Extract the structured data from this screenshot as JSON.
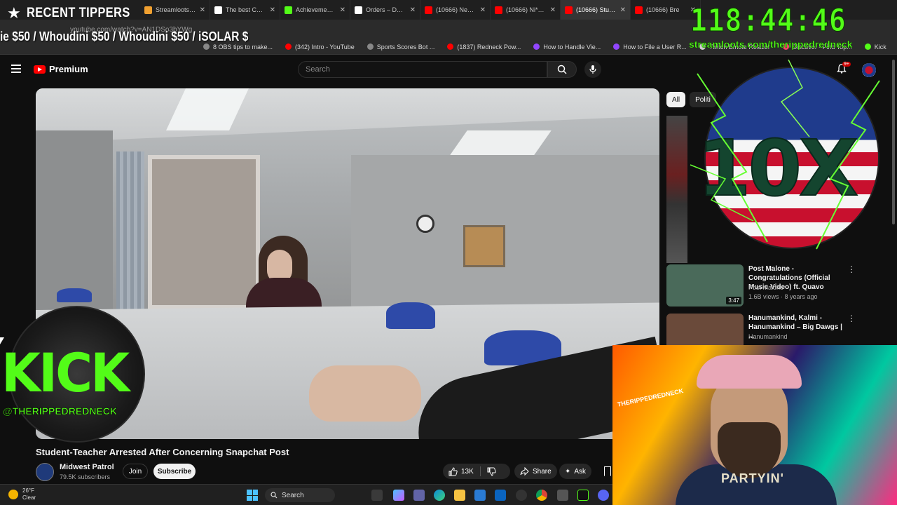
{
  "browser": {
    "tabs": [
      {
        "label": "Streamloots | Th",
        "color": "#f0a030",
        "active": false
      },
      {
        "label": "The best ChatB",
        "color": "#ffffff",
        "active": false
      },
      {
        "label": "Achievements -",
        "color": "#53fc18",
        "active": false
      },
      {
        "label": "Orders – Dashb",
        "color": "#ffffff",
        "active": false
      },
      {
        "label": "(10666) Next Fr",
        "color": "#ff0000",
        "active": false
      },
      {
        "label": "(10666) Ni**as",
        "color": "#ff0000",
        "active": false
      },
      {
        "label": "(10666) Studen",
        "color": "#ff0000",
        "active": true
      },
      {
        "label": "(10666) Bre",
        "color": "#ff0000",
        "active": false
      }
    ],
    "url": "youtube.com/watch?v=AN1DSo3bYWg",
    "bookmarks": [
      {
        "label": "8 OBS tips to make...",
        "color": "#888888"
      },
      {
        "label": "(342) Intro - YouTube",
        "color": "#ff0000"
      },
      {
        "label": "Sports Scores Bot ...",
        "color": "#888888"
      },
      {
        "label": "(1837) Redneck Pow...",
        "color": "#ff0000"
      },
      {
        "label": "How to Handle Vie...",
        "color": "#9146ff"
      },
      {
        "label": "How to File a User R...",
        "color": "#9146ff"
      },
      {
        "label": "Twitch Emote Resizer",
        "color": "#cccccc"
      },
      {
        "label": "Discover - Find Top...",
        "color": "#ff4466"
      },
      {
        "label": "Kick",
        "color": "#53fc18"
      }
    ]
  },
  "overlay": {
    "tippers_title": "RECENT TIPPERS",
    "ticker": "ie $50 / Whoudini $50 / Whoudini $50 / iSOLAR $",
    "timer": "118:44:46",
    "streamloots_url": "streamloots.com/therippedredneck",
    "flag_text": "10X",
    "kick_text": "KICK",
    "kick_handle": "@THERIPPEDREDNECK",
    "cam_shirt": "PARTYIN'",
    "cam_sign": "THERIPPEDREDNECK"
  },
  "youtube": {
    "logo_text": "Premium",
    "search_placeholder": "Search",
    "notification_count": "9+",
    "video": {
      "title": "Student-Teacher Arrested After Concerning Snapchat Post",
      "channel": "Midwest Patrol",
      "subscribers": "79.5K subscribers",
      "join_label": "Join",
      "subscribe_label": "Subscribe",
      "likes": "13K",
      "share_label": "Share",
      "ask_label": "Ask"
    },
    "chips": [
      {
        "label": "All",
        "active": true
      },
      {
        "label": "Politi",
        "active": false
      }
    ],
    "recommendations": [
      {
        "title": "Post Malone - Congratulations (Official Music Video) ft. Quavo",
        "channel": "Post Malone",
        "meta": "1.6B views · 8 years ago",
        "duration": "3:47",
        "thumb": "#4a6a5a"
      },
      {
        "title": "Hanumankind, Kalmi - Hanumankind – Big Dawgs | ...",
        "channel": "Hanumankind",
        "meta": "",
        "duration": "",
        "thumb": "#6a4a3a"
      }
    ]
  },
  "taskbar": {
    "temperature": "26°F",
    "weather": "Clear",
    "search_label": "Search"
  }
}
